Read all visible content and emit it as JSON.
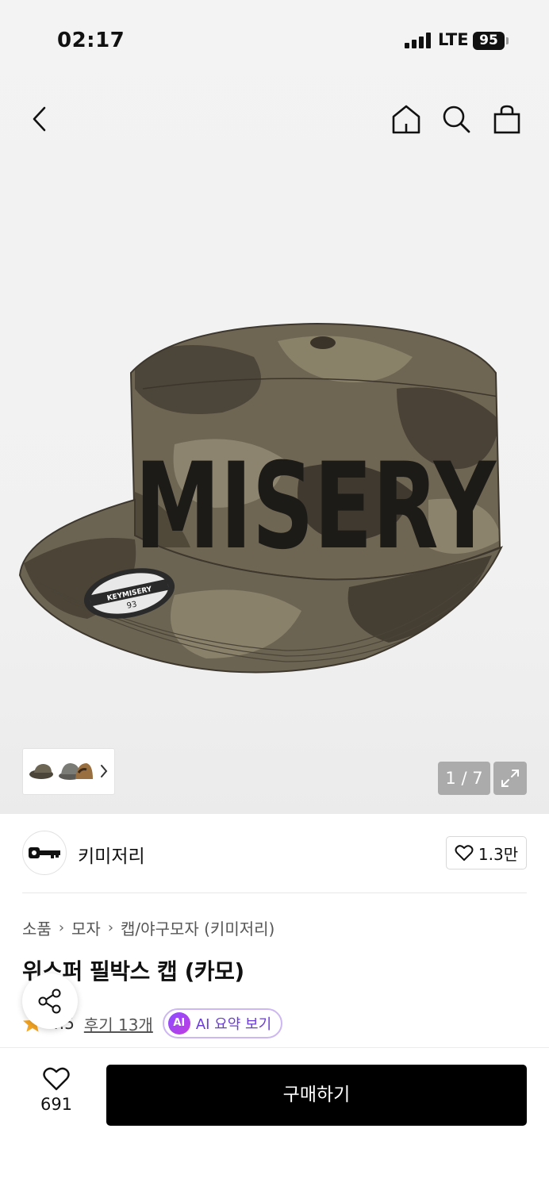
{
  "status_bar": {
    "time": "02:17",
    "network": "LTE",
    "battery": "95"
  },
  "gallery": {
    "counter": "1 / 7"
  },
  "brand": {
    "name": "키미저리",
    "likes": "1.3만"
  },
  "breadcrumb": [
    "소품",
    "모자",
    "캡/야구모자 (키미저리)"
  ],
  "product": {
    "title": "위스퍼 필박스 캡 (카모)",
    "rating": "4.5",
    "reviews_label": "후기 13개",
    "ai_badge": "AI",
    "ai_summary_label": "AI 요약 보기"
  },
  "hat_print": {
    "brand_text": "MISERY",
    "badge_text": "KEYMISERY",
    "size": "93"
  },
  "bottom": {
    "wish_count": "691",
    "buy_label": "구매하기"
  },
  "colors": {
    "accent_purple": "#6a3bd6",
    "star": "#f5a623",
    "buy_button": "#000000"
  },
  "icons": [
    "back-icon",
    "home-icon",
    "search-icon",
    "bag-icon",
    "expand-icon",
    "heart-icon",
    "share-icon",
    "star-icon",
    "chevron-right-icon"
  ]
}
